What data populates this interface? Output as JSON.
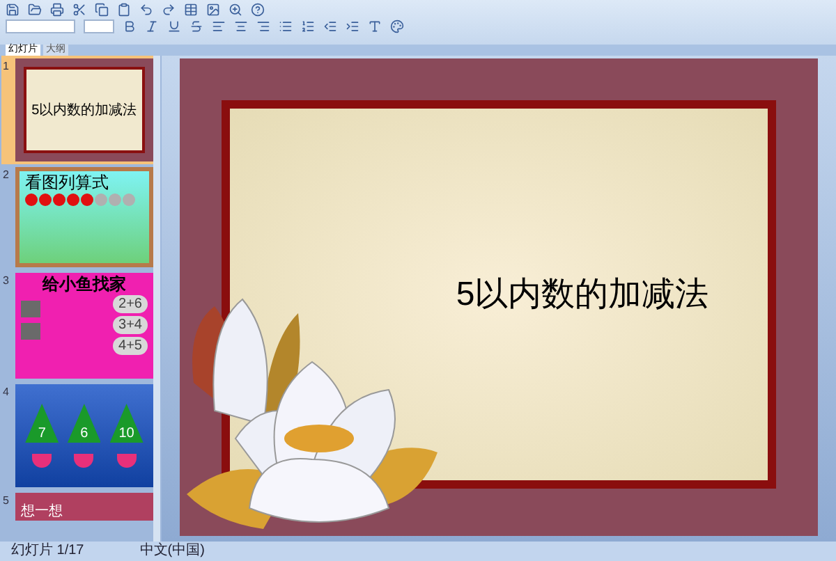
{
  "panel_tabs": [
    {
      "label": "幻灯片",
      "selected": true
    },
    {
      "label": "大纲",
      "selected": false
    }
  ],
  "slides": [
    {
      "number": "1",
      "selected": true,
      "kind": "title",
      "title": "5以内数的加减法"
    },
    {
      "number": "2",
      "selected": false,
      "kind": "equation",
      "title": "看图列算式"
    },
    {
      "number": "3",
      "selected": false,
      "kind": "fish",
      "title": "给小鱼找家",
      "clouds": [
        "2+6",
        "3+4",
        "4+5"
      ]
    },
    {
      "number": "4",
      "selected": false,
      "kind": "trees",
      "trees": [
        "7",
        "6",
        "10"
      ]
    },
    {
      "number": "5",
      "selected": false,
      "kind": "plain",
      "title": "想一想"
    }
  ],
  "current_slide": {
    "title": "5以内数的加减法"
  },
  "status_bar": [
    "幻灯片 1/17",
    "中文(中国)"
  ]
}
